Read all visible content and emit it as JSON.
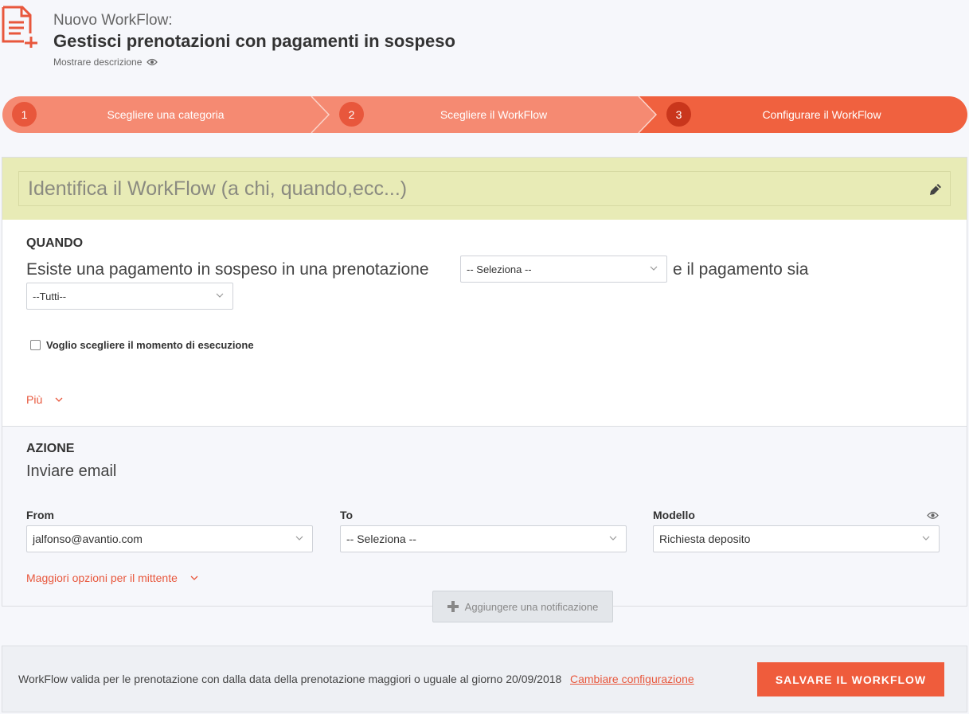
{
  "header": {
    "kicker": "Nuovo WorkFlow:",
    "title": "Gestisci prenotazioni con pagamenti in sospeso",
    "show_description": "Mostrare descrizione",
    "icon": "document-add-icon",
    "eye_icon": "eye-icon"
  },
  "steps": [
    {
      "number": "1",
      "label": "Scegliere una categoria",
      "state": "done"
    },
    {
      "number": "2",
      "label": "Scegliere il WorkFlow",
      "state": "done"
    },
    {
      "number": "3",
      "label": "Configurare il WorkFlow",
      "state": "active"
    }
  ],
  "identify": {
    "placeholder": "Identifica il WorkFlow (a chi, quando,ecc...)",
    "edit_icon": "pencil-icon"
  },
  "quando": {
    "title": "QUANDO",
    "sentence_part1": "Esiste una pagamento in sospeso in una prenotazione",
    "select1_value": "-- Seleziona --",
    "sentence_part2": "e il pagamento sia",
    "select2_value": "--Tutti--",
    "checkbox_label": "Voglio scegliere il momento di esecuzione",
    "checkbox_checked": false,
    "more_label": "Più"
  },
  "azione": {
    "title": "AZIONE",
    "action_name": "Inviare email",
    "from_label": "From",
    "from_value": "jalfonso@avantio.com",
    "to_label": "To",
    "to_value": "-- Seleziona --",
    "model_label": "Modello",
    "model_value": "Richiesta deposito",
    "sender_options_label": "Maggiori opzioni per il mittente"
  },
  "add_notification": {
    "label": "Aggiungere una notificazione",
    "icon": "plus-icon"
  },
  "footer": {
    "validity_text": "WorkFlow valida per le prenotazione con dalla data della prenotazione maggiori o uguale al giorno 20/09/2018",
    "change_link": "Cambiare configurazione",
    "save_label": "SALVARE IL WORKFLOW"
  },
  "colors": {
    "accent": "#ef5c3c",
    "step_done": "#f58a72",
    "step_active": "#f0613f",
    "ident_bg": "#e8ebb6"
  }
}
